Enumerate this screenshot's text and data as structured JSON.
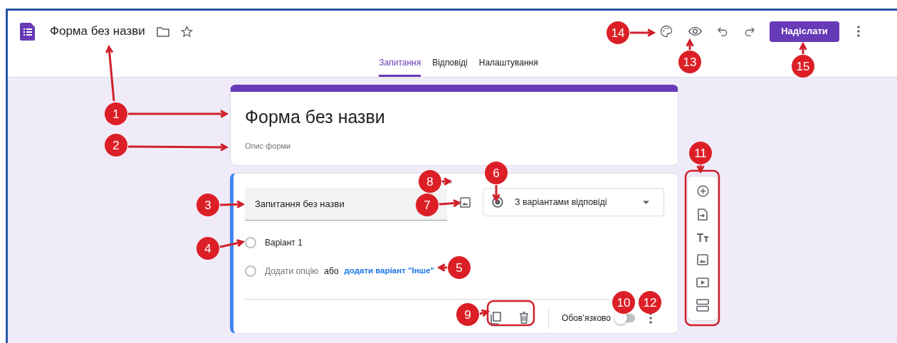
{
  "header": {
    "title": "Форма без назви",
    "send_button": "Надіслати"
  },
  "tabs": [
    {
      "label": "Запитання",
      "selected": true
    },
    {
      "label": "Відповіді",
      "selected": false
    },
    {
      "label": "Налаштування",
      "selected": false
    }
  ],
  "title_card": {
    "title": "Форма без назви",
    "placeholder": "Опис форми"
  },
  "question": {
    "title": "Запитання без назви",
    "type": "З варіантами відповіді",
    "options": [
      {
        "label": "Варіант 1",
        "selected": false
      }
    ],
    "add_option": {
      "placeholder": "Додати опцію",
      "selected": false
    },
    "or": "або",
    "add_other": "додати варіант \"Інше\"",
    "required_label": "Обов’язково",
    "required": false
  },
  "annotations": [
    "1",
    "2",
    "3",
    "4",
    "5",
    "6",
    "7",
    "8",
    "9",
    "10",
    "11",
    "12",
    "13",
    "14",
    "15"
  ]
}
